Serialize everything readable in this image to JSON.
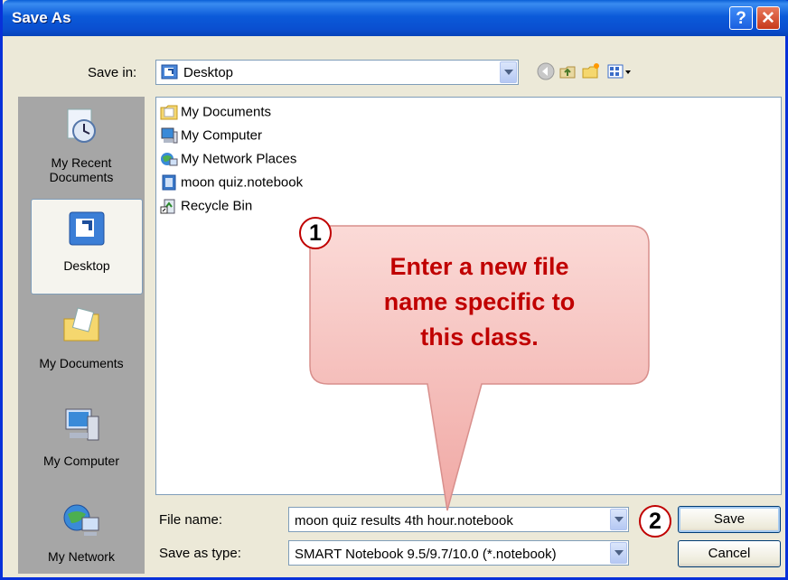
{
  "window": {
    "title": "Save As",
    "help_glyph": "?",
    "close_glyph": "✕"
  },
  "toolbar": {
    "save_in_label": "Save in:",
    "location": "Desktop"
  },
  "places": [
    {
      "label_line1": "My Recent",
      "label_line2": "Documents",
      "icon": "recent-documents-icon"
    },
    {
      "label_line1": "Desktop",
      "label_line2": "",
      "icon": "desktop-icon",
      "selected": true
    },
    {
      "label_line1": "My Documents",
      "label_line2": "",
      "icon": "my-documents-icon"
    },
    {
      "label_line1": "My Computer",
      "label_line2": "",
      "icon": "my-computer-icon"
    },
    {
      "label_line1": "My Network",
      "label_line2": "",
      "icon": "my-network-icon"
    }
  ],
  "files": [
    {
      "name": "My Documents",
      "icon": "folder-icon"
    },
    {
      "name": "My Computer",
      "icon": "computer-icon"
    },
    {
      "name": "My Network Places",
      "icon": "network-icon"
    },
    {
      "name": "moon quiz.notebook",
      "icon": "notebook-file-icon"
    },
    {
      "name": "Recycle Bin",
      "icon": "recycle-bin-icon"
    }
  ],
  "form": {
    "file_name_label": "File name:",
    "file_name_value": "moon quiz results 4th hour.notebook",
    "save_type_label": "Save as type:",
    "save_type_value": "SMART Notebook 9.5/9.7/10.0 (*.notebook)",
    "save_button": "Save",
    "cancel_button": "Cancel"
  },
  "annotations": {
    "step1": "1",
    "callout_line1": "Enter a new file",
    "callout_line2": "name specific to",
    "callout_line3": "this class.",
    "step2": "2"
  },
  "colors": {
    "callout_fill": "#f3b5b2",
    "callout_text": "#c00000",
    "title_bar": "#0a5fd7"
  }
}
